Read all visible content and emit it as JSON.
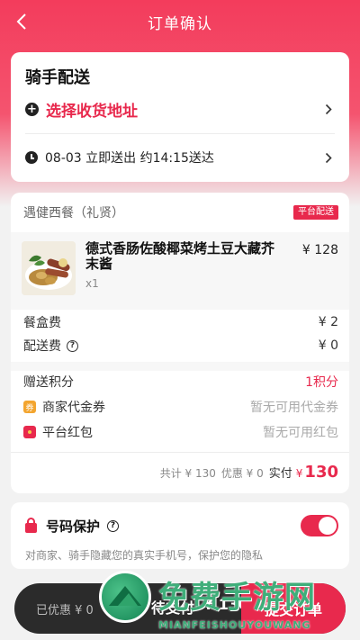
{
  "header": {
    "title": "订单确认"
  },
  "delivery": {
    "title": "骑手配送",
    "select_address": "选择收货地址",
    "time_text": "08-03 立即送出 约14:15送达"
  },
  "order": {
    "store_name": "遇健西餐（礼贤）",
    "platform_badge": "平台配送",
    "item": {
      "name": "德式香肠佐酸椰菜烤土豆大藏芥末酱",
      "qty": "x1",
      "price": "¥ 128"
    },
    "fees": [
      {
        "label": "餐盒费",
        "value": "¥ 2"
      },
      {
        "label": "配送费",
        "value": "¥ 0"
      }
    ],
    "points": {
      "label": "赠送积分",
      "value": "1积分"
    },
    "merchant_coupon": {
      "label": "商家代金券",
      "value": "暂无可用代金券",
      "icon_text": "券"
    },
    "red_packet": {
      "label": "平台红包",
      "value": "暂无可用红包"
    },
    "summary": {
      "total": "共计 ¥ 130",
      "discount": "优惠 ¥ 0",
      "actual_label": "实付",
      "actual_currency": "¥",
      "actual_value": "130"
    }
  },
  "privacy": {
    "title": "号码保护",
    "description": "对商家、骑手隐藏您的真实手机号，保护您的隐私",
    "enabled": true
  },
  "bottom_bar": {
    "discount": "已优惠 ¥ 0",
    "pay_label": "待支付",
    "pay_amount": "¥ 130",
    "submit": "提交订单"
  },
  "watermark": {
    "main": "免费手游网",
    "sub": "MIANFEISHOUYOUWANG"
  },
  "colors": {
    "accent": "#e8294d",
    "header": "#f33c5c",
    "bar": "#2b2b2b"
  },
  "icons": [
    "back-arrow-icon",
    "plus-icon",
    "chevron-right-icon",
    "clock-icon",
    "help-icon",
    "coupon-icon",
    "red-packet-icon",
    "lock-icon"
  ]
}
